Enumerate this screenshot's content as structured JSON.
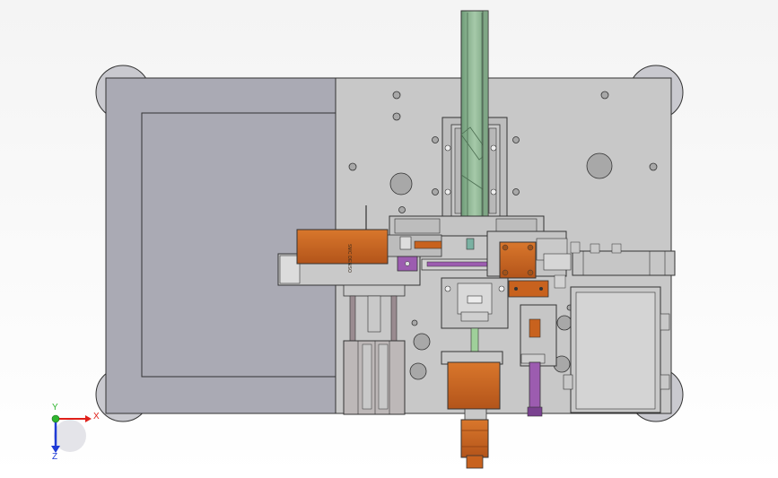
{
  "model": {
    "cylinder_label": "SMC DENSO"
  },
  "triad": {
    "x_label": "X",
    "y_label": "Y",
    "z_label": "Z"
  },
  "colors": {
    "background": "#ffffff",
    "plate_light": "#c6c6c6",
    "plate_dark": "#a9a9b4",
    "green_rail": "#8fb795",
    "orange_part": "#c8621e",
    "purple_part": "#9c5cb0",
    "axis_x": "#e0201a",
    "axis_y": "#2fb52f",
    "axis_z": "#1f3bd6"
  }
}
